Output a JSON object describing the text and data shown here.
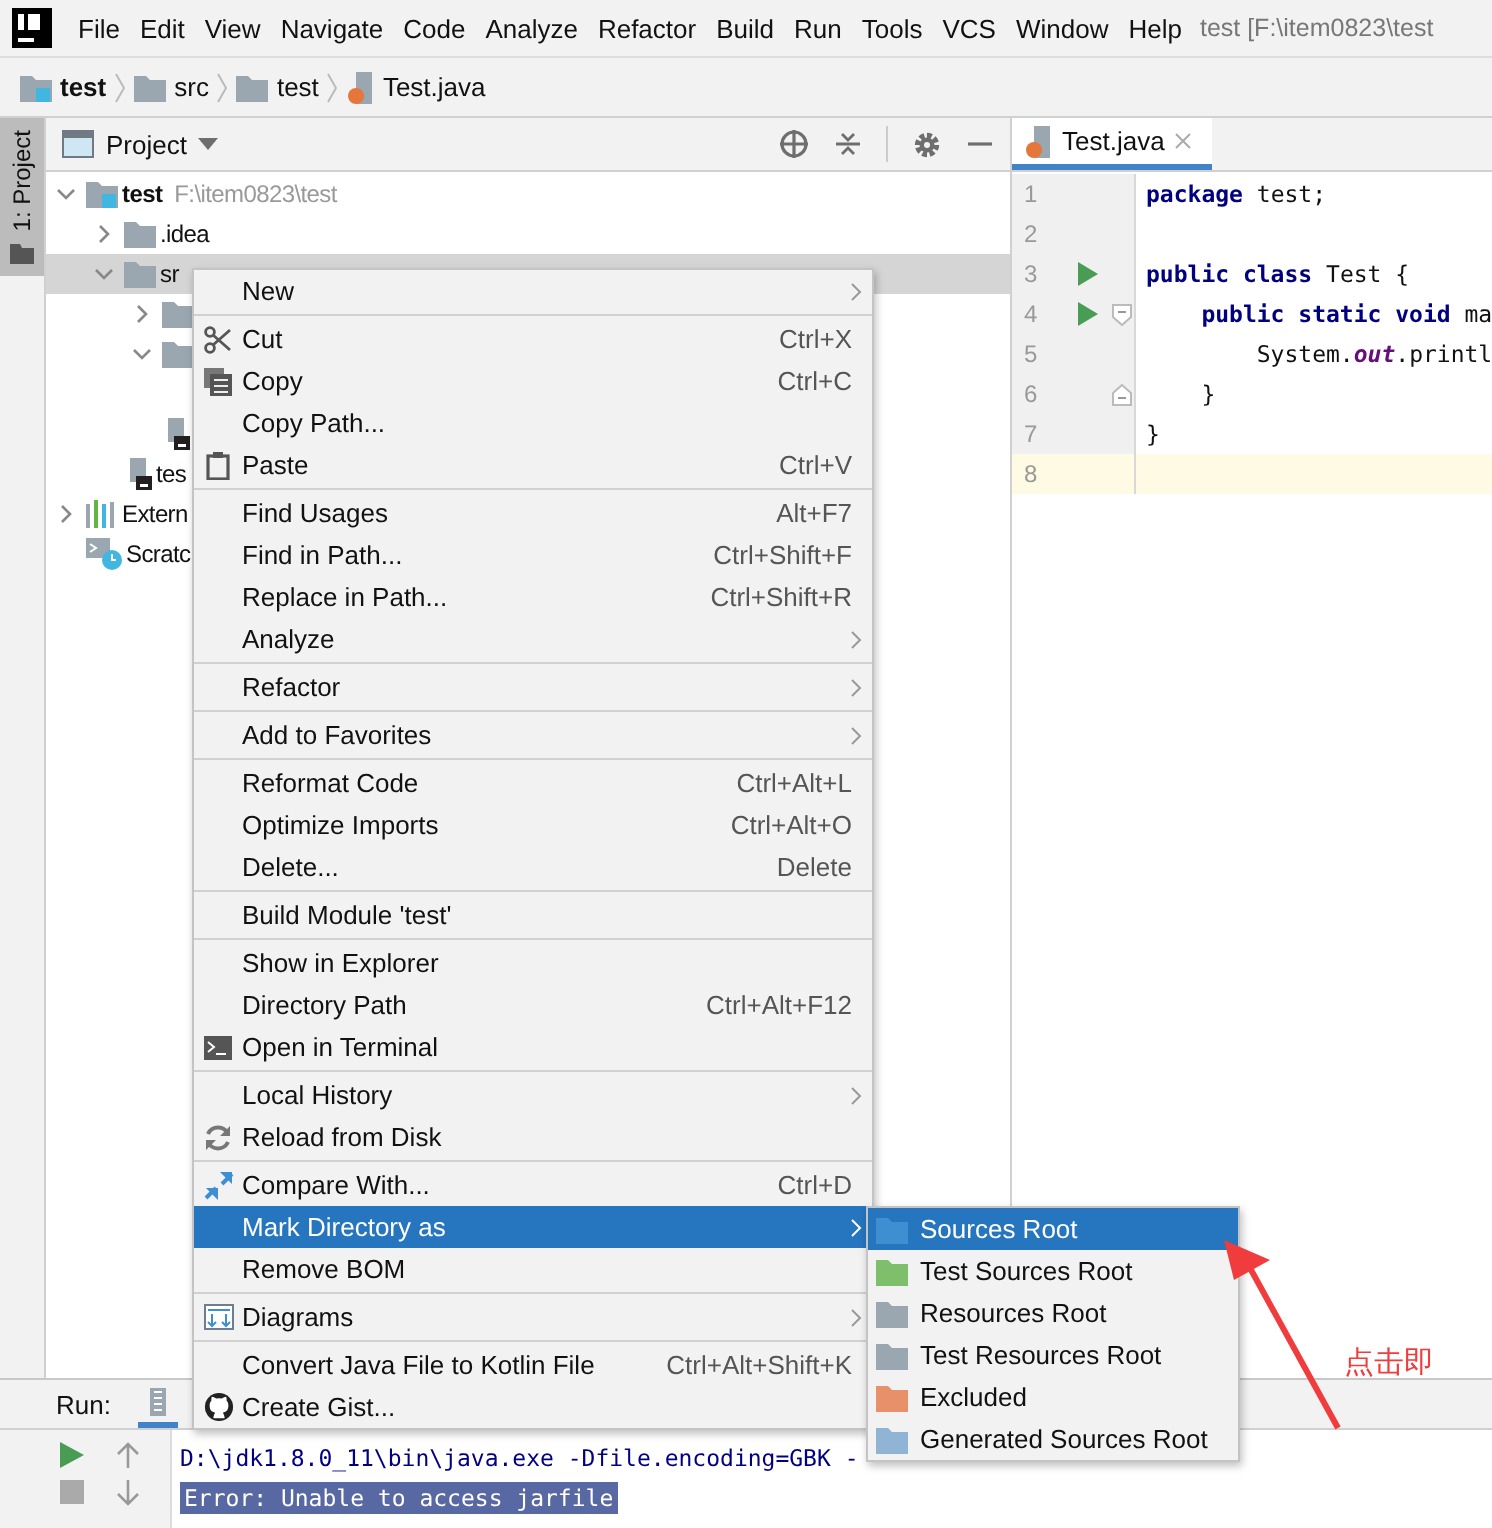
{
  "menubar": {
    "items": [
      "File",
      "Edit",
      "View",
      "Navigate",
      "Code",
      "Analyze",
      "Refactor",
      "Build",
      "Run",
      "Tools",
      "VCS",
      "Window",
      "Help"
    ],
    "title": "test [F:\\item0823\\test"
  },
  "breadcrumb": [
    {
      "label": "test",
      "kind": "module"
    },
    {
      "label": "src",
      "kind": "folder"
    },
    {
      "label": "test",
      "kind": "folder"
    },
    {
      "label": "Test.java",
      "kind": "java"
    }
  ],
  "side_strip": {
    "label": "1: Project"
  },
  "project_panel": {
    "title": "Project",
    "tree": [
      {
        "name": "test",
        "path": "F:\\item0823\\test",
        "kind": "module",
        "expanded": true,
        "selected": false,
        "children": [
          {
            "name": ".idea",
            "kind": "folder",
            "expanded": false,
            "selected": false
          },
          {
            "name": "sr",
            "kind": "folder",
            "expanded": true,
            "selected": true,
            "children": [
              {
                "kind": "folder",
                "expanded": false,
                "selected": false
              },
              {
                "kind": "folder",
                "expanded": true,
                "selected": false
              },
              {
                "kind": "file",
                "selected": false
              }
            ]
          },
          {
            "name": "tes",
            "kind": "file",
            "selected": false
          }
        ]
      },
      {
        "name": "Extern",
        "kind": "library",
        "expanded": false,
        "selected": false
      },
      {
        "name": "Scratc",
        "kind": "scratches",
        "selected": false
      }
    ]
  },
  "editor": {
    "tab": {
      "label": "Test.java",
      "selected": true
    },
    "lines": [
      {
        "number": "1",
        "run": false,
        "fold_start": false,
        "fold_end": false,
        "current": false,
        "tokens": [
          {
            "text": "package",
            "kind": "keyword"
          },
          {
            "text": " test;",
            "kind": "plain"
          }
        ]
      },
      {
        "number": "2",
        "run": false,
        "fold_start": false,
        "fold_end": false,
        "current": false
      },
      {
        "number": "3",
        "run": true,
        "fold_start": false,
        "fold_end": false,
        "current": false,
        "tokens": [
          {
            "text": "public class",
            "kind": "keyword"
          },
          {
            "text": " Test {",
            "kind": "plain"
          }
        ]
      },
      {
        "number": "4",
        "run": true,
        "fold_start": true,
        "fold_end": false,
        "current": false,
        "tokens": [
          {
            "text": "    public static void",
            "kind": "keyword"
          },
          {
            "text": " ma",
            "kind": "plain"
          }
        ]
      },
      {
        "number": "5",
        "run": false,
        "fold_start": false,
        "fold_end": false,
        "current": false,
        "tokens": [
          {
            "text": "        System.",
            "kind": "plain"
          },
          {
            "text": "out",
            "kind": "field"
          },
          {
            "text": ".printl",
            "kind": "plain"
          }
        ]
      },
      {
        "number": "6",
        "run": false,
        "fold_start": false,
        "fold_end": true,
        "current": false,
        "tokens": [
          {
            "text": "    }",
            "kind": "plain"
          }
        ]
      },
      {
        "number": "7",
        "run": false,
        "fold_start": false,
        "fold_end": false,
        "current": false,
        "tokens": [
          {
            "text": "}",
            "kind": "plain"
          }
        ]
      },
      {
        "number": "8",
        "run": false,
        "fold_start": false,
        "fold_end": false,
        "current": true
      }
    ]
  },
  "run_panel": {
    "label": "Run:",
    "console": [
      {
        "text": "D:\\jdk1.8.0_11\\bin\\java.exe -Dfile.encoding=GBK -",
        "selected": false
      },
      {
        "text": "Error: Unable to access jarfile",
        "selected": true
      }
    ]
  },
  "context_menu": {
    "groups": [
      [
        {
          "label": "New",
          "submenu": true,
          "selected": false
        }
      ],
      [
        {
          "label": "Cut",
          "shortcut": "Ctrl+X",
          "submenu": false,
          "selected": false
        },
        {
          "label": "Copy",
          "shortcut": "Ctrl+C",
          "submenu": false,
          "selected": false
        },
        {
          "label": "Copy Path...",
          "submenu": false,
          "selected": false
        },
        {
          "label": "Paste",
          "shortcut": "Ctrl+V",
          "submenu": false,
          "selected": false
        }
      ],
      [
        {
          "label": "Find Usages",
          "shortcut": "Alt+F7",
          "submenu": false,
          "selected": false
        },
        {
          "label": "Find in Path...",
          "shortcut": "Ctrl+Shift+F",
          "submenu": false,
          "selected": false
        },
        {
          "label": "Replace in Path...",
          "shortcut": "Ctrl+Shift+R",
          "submenu": false,
          "selected": false
        },
        {
          "label": "Analyze",
          "submenu": true,
          "selected": false
        }
      ],
      [
        {
          "label": "Refactor",
          "submenu": true,
          "selected": false
        }
      ],
      [
        {
          "label": "Add to Favorites",
          "submenu": true,
          "selected": false
        }
      ],
      [
        {
          "label": "Reformat Code",
          "shortcut": "Ctrl+Alt+L",
          "submenu": false,
          "selected": false
        },
        {
          "label": "Optimize Imports",
          "shortcut": "Ctrl+Alt+O",
          "submenu": false,
          "selected": false
        },
        {
          "label": "Delete...",
          "shortcut": "Delete",
          "submenu": false,
          "selected": false
        }
      ],
      [
        {
          "label": "Build Module 'test'",
          "submenu": false,
          "selected": false
        }
      ],
      [
        {
          "label": "Show in Explorer",
          "submenu": false,
          "selected": false
        },
        {
          "label": "Directory Path",
          "shortcut": "Ctrl+Alt+F12",
          "submenu": false,
          "selected": false
        },
        {
          "label": "Open in Terminal",
          "submenu": false,
          "selected": false
        }
      ],
      [
        {
          "label": "Local History",
          "submenu": true,
          "selected": false
        },
        {
          "label": "Reload from Disk",
          "submenu": false,
          "selected": false
        }
      ],
      [
        {
          "label": "Compare With...",
          "shortcut": "Ctrl+D",
          "submenu": false,
          "selected": false
        },
        {
          "label": "Mark Directory as",
          "submenu": true,
          "selected": true
        },
        {
          "label": "Remove BOM",
          "submenu": false,
          "selected": false
        }
      ],
      [
        {
          "label": "Diagrams",
          "submenu": true,
          "selected": false
        }
      ],
      [
        {
          "label": "Convert Java File to Kotlin File",
          "shortcut": "Ctrl+Alt+Shift+K",
          "submenu": false,
          "selected": false
        },
        {
          "label": "Create Gist...",
          "submenu": false,
          "selected": false
        }
      ]
    ]
  },
  "submenu": {
    "items": [
      {
        "label": "Sources Root",
        "color": "#3d8fd1",
        "selected": true
      },
      {
        "label": "Test Sources Root",
        "color": "#7dbf6a",
        "selected": false
      },
      {
        "label": "Resources Root",
        "color": "#9aa7b0",
        "selected": false
      },
      {
        "label": "Test Resources Root",
        "color": "#9aa7b0",
        "selected": false
      },
      {
        "label": "Excluded",
        "color": "#e8906a",
        "selected": false
      },
      {
        "label": "Generated Sources Root",
        "color": "#8fb4d4",
        "selected": false
      }
    ]
  },
  "annotation": {
    "text": "点击即"
  }
}
